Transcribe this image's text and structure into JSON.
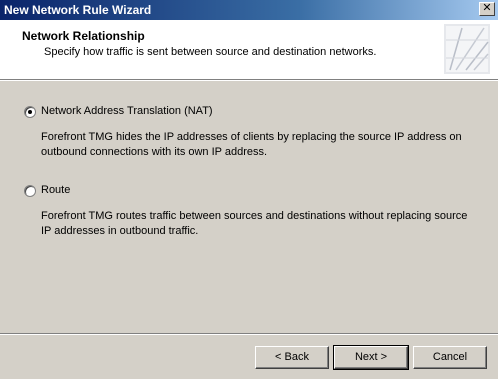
{
  "window": {
    "title": "New Network Rule Wizard",
    "close_glyph": "✕"
  },
  "header": {
    "title": "Network Relationship",
    "subtitle": "Specify how traffic is sent between source and destination networks.",
    "logo_icon": "forefront-wizard-logo-icon"
  },
  "options": [
    {
      "label": "Network Address Translation (NAT)",
      "selected": true,
      "description_line1": "Forefront TMG hides the IP addresses of clients by replacing  the source IP address on",
      "description_line2": "outbound connections with its own IP address."
    },
    {
      "label": "Route",
      "selected": false,
      "description_line1": "Forefront TMG routes traffic between sources and destinations without replacing source",
      "description_line2": "IP addresses in outbound traffic."
    }
  ],
  "buttons": {
    "back": "< Back",
    "next": "Next >",
    "cancel": "Cancel"
  }
}
